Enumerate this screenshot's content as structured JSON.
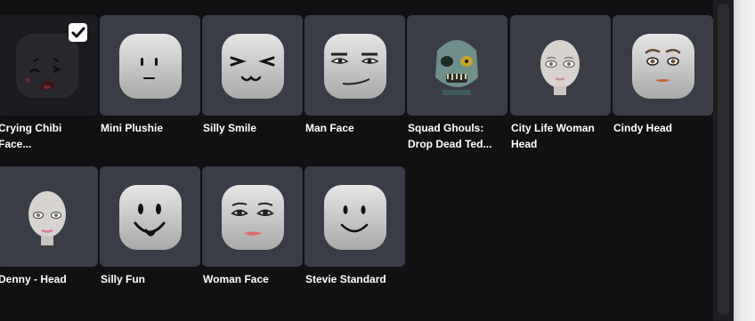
{
  "items": [
    {
      "name": "Crying Chibi Face...",
      "selected": true,
      "icon": "crying-chibi-face-icon"
    },
    {
      "name": "Mini Plushie",
      "selected": false,
      "icon": "mini-plushie-face-icon"
    },
    {
      "name": "Silly Smile",
      "selected": false,
      "icon": "silly-smile-face-icon"
    },
    {
      "name": "Man Face",
      "selected": false,
      "icon": "man-face-icon"
    },
    {
      "name": "Squad Ghouls: Drop Dead Ted...",
      "selected": false,
      "icon": "zombie-head-icon"
    },
    {
      "name": "City Life Woman Head",
      "selected": false,
      "icon": "city-life-woman-head-icon"
    },
    {
      "name": "Cindy Head",
      "selected": false,
      "icon": "cindy-head-icon"
    },
    {
      "name": "Denny - Head",
      "selected": false,
      "icon": "denny-head-icon"
    },
    {
      "name": "Silly Fun",
      "selected": false,
      "icon": "silly-fun-face-icon"
    },
    {
      "name": "Woman Face",
      "selected": false,
      "icon": "woman-face-icon"
    },
    {
      "name": "Stevie Standard",
      "selected": false,
      "icon": "stevie-standard-face-icon"
    }
  ],
  "colors": {
    "card": "#3a3d46",
    "selected_card": "#1b1b20",
    "background": "#111114",
    "label": "#ffffff"
  }
}
